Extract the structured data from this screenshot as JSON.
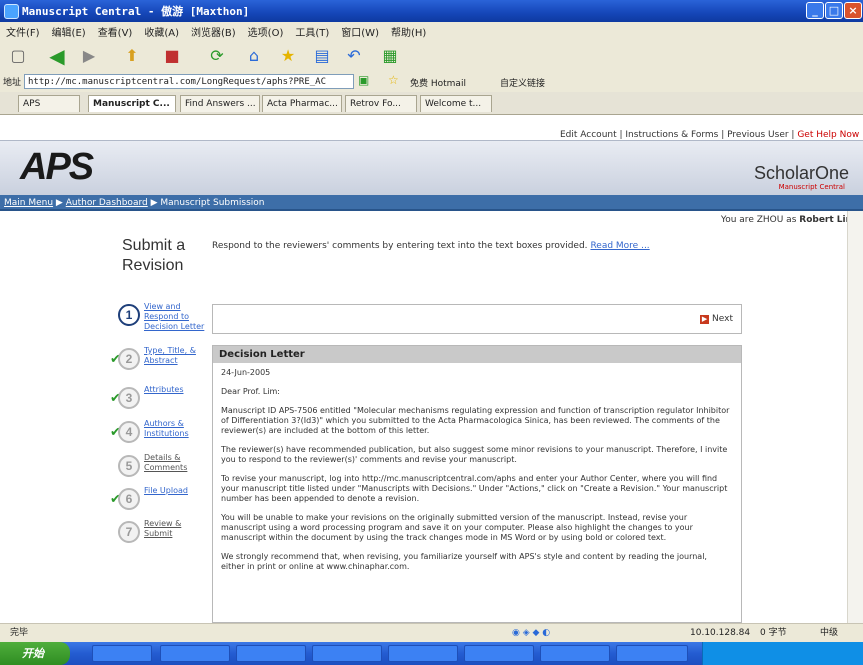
{
  "window": {
    "title": "Manuscript Central - 傲游 [Maxthon]"
  },
  "menu": [
    "文件(F)",
    "编辑(E)",
    "查看(V)",
    "收藏(A)",
    "浏览器(B)",
    "选项(O)",
    "工具(T)",
    "窗口(W)",
    "帮助(H)"
  ],
  "address": {
    "label": "地址",
    "url": "http://mc.manuscriptcentral.com/LongRequest/aphs?PRE_AC",
    "links": [
      "免费 Hotmail",
      "自定义链接"
    ]
  },
  "tabs": [
    "APS",
    "Manuscript C...",
    "Find Answers ...",
    "Acta Pharmac...",
    "Retrov Fo...",
    "Welcome t..."
  ],
  "top_links": {
    "edit_account": "Edit Account",
    "instructions": "Instructions & Forms",
    "previous_user": "Previous User",
    "get_help": "Get Help Now"
  },
  "logos": {
    "aps": "APS",
    "scholarone": "ScholarOne",
    "scholarone_sub": "Manuscript Central"
  },
  "breadcrumb": {
    "main_menu": "Main Menu",
    "author_dashboard": "Author Dashboard",
    "current": "Manuscript Submission"
  },
  "user_line": {
    "prefix": "You are ZHOU as",
    "name": "Robert Lim"
  },
  "page": {
    "title_line1": "Submit a",
    "title_line2": "Revision",
    "instructions": "Respond to the reviewers' comments by entering text into the text boxes provided.",
    "read_more": "Read More ..."
  },
  "steps": [
    {
      "num": "1",
      "label": "View and Respond to Decision Letter",
      "state": "current"
    },
    {
      "num": "2",
      "label": "Type, Title, & Abstract",
      "state": "done"
    },
    {
      "num": "3",
      "label": "Attributes",
      "state": "done"
    },
    {
      "num": "4",
      "label": "Authors & Institutions",
      "state": "done"
    },
    {
      "num": "5",
      "label": "Details & Comments",
      "state": "pending"
    },
    {
      "num": "6",
      "label": "File Upload",
      "state": "done"
    },
    {
      "num": "7",
      "label": "Review & Submit",
      "state": "pending"
    }
  ],
  "next_button": "Next",
  "letter": {
    "heading": "Decision Letter",
    "date": "24-Jun-2005",
    "salutation": "Dear Prof. Lim:",
    "paragraphs": [
      "Manuscript ID APS-7506 entitled \"Molecular mechanisms regulating expression and function of transcription regulator Inhibitor of Differentiation 3?(Id3)\" which you submitted to the Acta Pharmacologica Sinica, has been reviewed. The comments of the reviewer(s) are included at the bottom of this letter.",
      "The reviewer(s) have recommended publication, but also suggest some minor revisions to your manuscript. Therefore, I invite you to respond to the reviewer(s)' comments and revise your manuscript.",
      "To revise your manuscript, log into http://mc.manuscriptcentral.com/aphs and enter your Author Center, where you will find your manuscript title listed under \"Manuscripts with Decisions.\" Under \"Actions,\" click on \"Create a Revision.\" Your manuscript number has been appended to denote a revision.",
      "You will be unable to make your revisions on the originally submitted version of the manuscript. Instead, revise your manuscript using a word processing program and save it on your computer. Please also highlight the changes to your manuscript within the document by using the track changes mode in MS Word or by using bold or colored text.",
      "We strongly recommend that, when revising, you familiarize yourself with APS's style and content by reading the journal, either in print or online at www.chinaphar.com."
    ]
  },
  "status": {
    "left": "完毕",
    "ip": "10.10.128.84",
    "zoom": "0 字节",
    "mode": "中级"
  },
  "taskbar": {
    "start": "开始"
  }
}
